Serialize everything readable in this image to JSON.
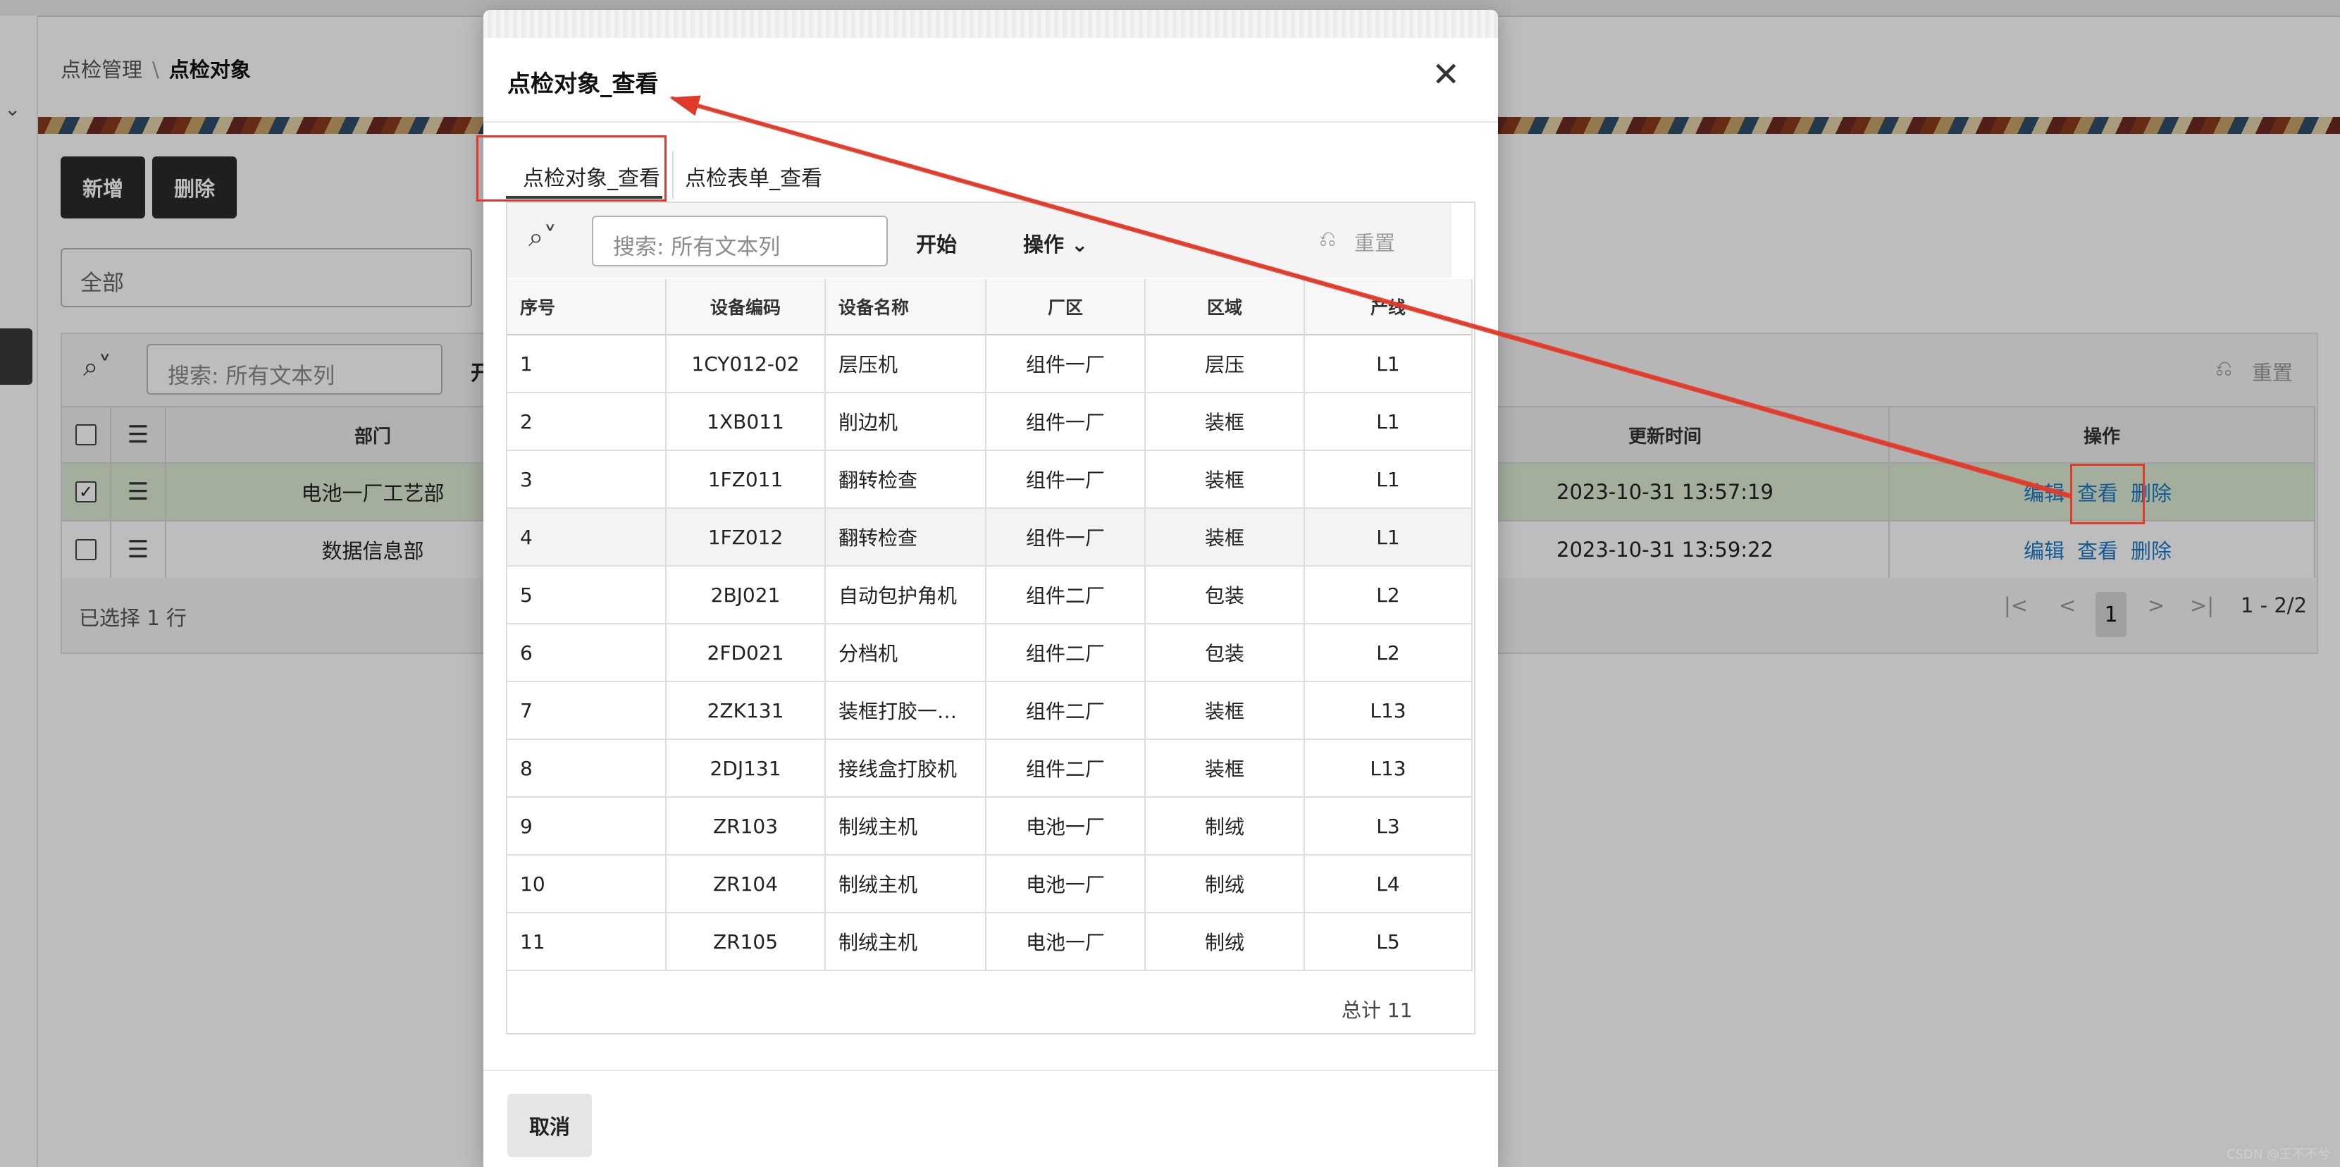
{
  "breadcrumb": {
    "parent": "点检管理",
    "separator": "\\",
    "current": "点检对象"
  },
  "toolbar": {
    "add_label": "新增",
    "delete_label": "删除"
  },
  "filter": {
    "value": "全部"
  },
  "report": {
    "search_placeholder": "搜索: 所有文本列",
    "go_label": "开",
    "reset_label": "重置",
    "columns": {
      "dept": "部门",
      "updated": "更新时间",
      "actions": "操作"
    },
    "rows": [
      {
        "dept": "电池一厂工艺部",
        "updated": "2023-10-31 13:57:19",
        "selected": true
      },
      {
        "dept": "数据信息部",
        "updated": "2023-10-31 13:59:22",
        "selected": false
      }
    ],
    "row_actions": {
      "edit": "编辑",
      "view": "查看",
      "delete": "删除"
    },
    "selected_text": "已选择 1 行",
    "pager": {
      "first": "|<",
      "prev": "<",
      "current": "1",
      "next": ">",
      "last": ">|",
      "range": "1 - 2/2"
    }
  },
  "dialog": {
    "title": "点检对象_查看",
    "close_glyph": "✕",
    "tabs": [
      {
        "label": "点检对象_查看",
        "active": true
      },
      {
        "label": "点检表单_查看",
        "active": false
      }
    ],
    "search_placeholder": "搜索: 所有文本列",
    "go_label": "开始",
    "actions_label": "操作",
    "reset_label": "重置",
    "columns": [
      "序号",
      "设备编码",
      "设备名称",
      "厂区",
      "区域",
      "产线"
    ],
    "rows": [
      [
        "1",
        "1CY012-02",
        "层压机",
        "组件一厂",
        "层压",
        "L1"
      ],
      [
        "2",
        "1XB011",
        "削边机",
        "组件一厂",
        "装框",
        "L1"
      ],
      [
        "3",
        "1FZ011",
        "翻转检查",
        "组件一厂",
        "装框",
        "L1"
      ],
      [
        "4",
        "1FZ012",
        "翻转检查",
        "组件一厂",
        "装框",
        "L1"
      ],
      [
        "5",
        "2BJ021",
        "自动包护角机",
        "组件二厂",
        "包装",
        "L2"
      ],
      [
        "6",
        "2FD021",
        "分档机",
        "组件二厂",
        "包装",
        "L2"
      ],
      [
        "7",
        "2ZK131",
        "装框打胶一…",
        "组件二厂",
        "装框",
        "L13"
      ],
      [
        "8",
        "2DJ131",
        "接线盒打胶机",
        "组件二厂",
        "装框",
        "L13"
      ],
      [
        "9",
        "ZR103",
        "制绒主机",
        "电池一厂",
        "制绒",
        "L3"
      ],
      [
        "10",
        "ZR104",
        "制绒主机",
        "电池一厂",
        "制绒",
        "L4"
      ],
      [
        "11",
        "ZR105",
        "制绒主机",
        "电池一厂",
        "制绒",
        "L5"
      ]
    ],
    "total_text": "总计 11",
    "cancel_label": "取消"
  },
  "watermark": "CSDN @王不不兮",
  "colors": {
    "annotation": "#e23a2a",
    "link": "#1a7ac8",
    "selected_row": "#dcebd4",
    "dark_button": "#2d2a28"
  }
}
